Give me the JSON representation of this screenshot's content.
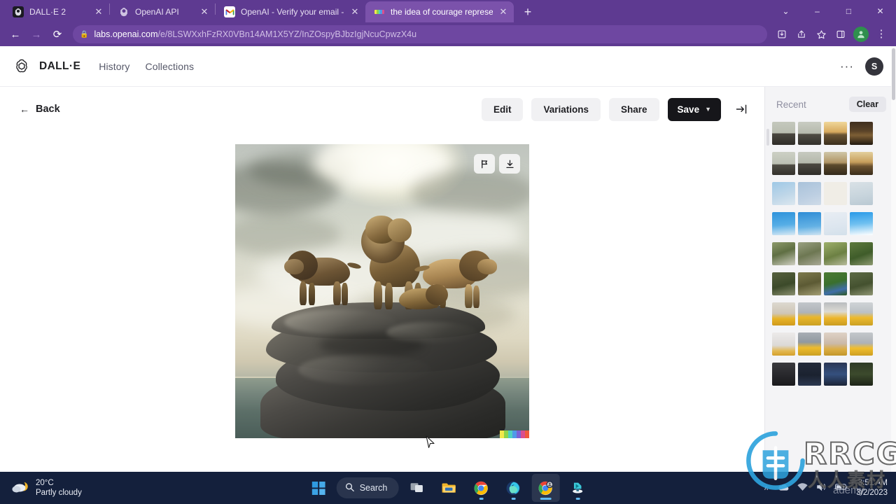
{
  "browser": {
    "tabs": [
      {
        "title": "DALL·E 2",
        "favicon": "openai-icon",
        "active": false
      },
      {
        "title": "OpenAI API",
        "favicon": "openai-icon",
        "active": false
      },
      {
        "title": "OpenAI - Verify your email - sam",
        "favicon": "gmail-icon",
        "active": false
      },
      {
        "title": "the idea of courage represented",
        "favicon": "dalle-swatch-icon",
        "active": true
      }
    ],
    "new_tab_label": "+",
    "window_controls": {
      "minimize": "–",
      "maximize": "□",
      "close": "✕",
      "chevron": "⌄"
    },
    "nav": {
      "back": "←",
      "forward": "→",
      "reload": "⟳"
    },
    "omnibox": {
      "lock_icon": "lock-icon",
      "url_host": "labs.openai.com",
      "url_path": "/e/8LSWXxhFzRX0VBn14AM1X5YZ/InZOspyBJbzIgjNcuCpwzX4u"
    },
    "toolbar_icons": [
      "install-icon",
      "share-icon",
      "bookmark-star-icon",
      "sidepanel-icon",
      "profile-avatar-icon",
      "menu-kebab-icon"
    ]
  },
  "app": {
    "logo": "openai-logo-icon",
    "brand": "DALL·E",
    "nav_links": [
      "History",
      "Collections"
    ],
    "overflow_label": "···",
    "avatar_initial": "S"
  },
  "toolbar": {
    "back_label": "Back",
    "back_arrow": "←",
    "edit_label": "Edit",
    "variations_label": "Variations",
    "share_label": "Share",
    "save_label": "Save",
    "save_chevron": "∨",
    "collapse_icon": "collapse-panel-icon"
  },
  "image": {
    "alt_prompt": "the idea of courage represented",
    "flag_icon": "flag-icon",
    "download_icon": "download-icon",
    "watermark_colors": [
      "#f2e84b",
      "#8fd44a",
      "#4fd0c0",
      "#4f9ae8",
      "#7a63d6",
      "#d94f8e",
      "#ef5a3c"
    ]
  },
  "rail": {
    "title": "Recent",
    "clear_label": "Clear",
    "thumbnail_rows": [
      {
        "subject": "lions-on-rock",
        "tones": [
          "#b4b6a8",
          "#9fa79a",
          "#d9b878",
          "#4b3a2c"
        ]
      },
      {
        "subject": "lions-on-rock",
        "tones": [
          "#bdbfb0",
          "#a8aca0",
          "#c2b08a",
          "#c99a5c"
        ]
      },
      {
        "subject": "sky-birds",
        "tones": [
          "#a8cce6",
          "#b6c6dc",
          "#eceae4",
          "#d3dbe0"
        ]
      },
      {
        "subject": "blue-sky",
        "tones": [
          "#3d9fe0",
          "#3f93d8",
          "#e4ecf4",
          "#39a7ee"
        ]
      },
      {
        "subject": "forest-hiker",
        "tones": [
          "#6e7f55",
          "#7f8a68",
          "#879466",
          "#5d7043"
        ]
      },
      {
        "subject": "forest-hiker",
        "tones": [
          "#5f6b4c",
          "#74764f",
          "#4d6f3c",
          "#5d6a48"
        ]
      },
      {
        "subject": "yellow-taxi",
        "tones": [
          "#d9b256",
          "#b9bcc0",
          "#c9a054",
          "#c8cbcd"
        ]
      },
      {
        "subject": "yellow-taxi",
        "tones": [
          "#dcd8d2",
          "#9aa0a6",
          "#d9c3ae",
          "#b9bcc1"
        ]
      },
      {
        "subject": "night-city",
        "tones": [
          "#2b2b30",
          "#1d2430",
          "#2a3550",
          "#2f3a2a"
        ]
      }
    ]
  },
  "taskbar": {
    "weather": {
      "temperature": "20°C",
      "condition": "Partly cloudy",
      "icon": "partly-cloudy-icon"
    },
    "start_icon": "windows-start-icon",
    "search_label": "Search",
    "search_icon": "search-icon",
    "apps": [
      "task-view-icon",
      "file-explorer-icon",
      "chrome-icon",
      "edge-copilot-icon",
      "chrome-profile-icon",
      "video-editor-icon"
    ],
    "tray": {
      "chevron": "∧",
      "icons": [
        "onedrive-icon",
        "network-icon",
        "volume-icon",
        "battery-icon"
      ]
    },
    "clock": {
      "time": "3:51 AM",
      "date": "3/2/2023"
    }
  },
  "watermark": {
    "text": "RRCG",
    "subtext": "人人素材",
    "tail": "ademy"
  }
}
